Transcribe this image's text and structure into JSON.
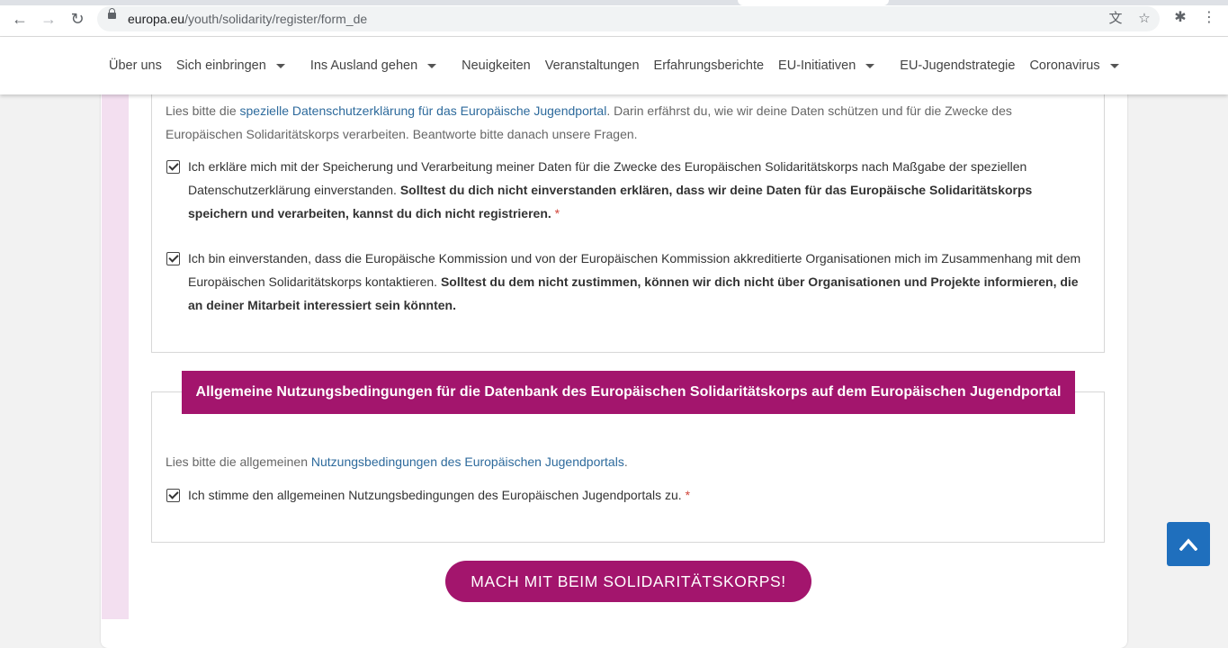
{
  "browser": {
    "url_domain": "europa.eu",
    "url_path": "/youth/solidarity/register/form_de",
    "back_icon": "←",
    "forward_icon": "→",
    "reload_icon": "↻",
    "translate_icon": "文",
    "star_icon": "☆",
    "extensions_icon": "✱",
    "menu_icon": "⋮"
  },
  "nav": {
    "items": [
      {
        "label": "Über uns",
        "dropdown": false
      },
      {
        "label": "Sich einbringen",
        "dropdown": true
      },
      {
        "label": "Ins Ausland gehen",
        "dropdown": true
      },
      {
        "label": "Neuigkeiten",
        "dropdown": false
      },
      {
        "label": "Veranstaltungen",
        "dropdown": false
      },
      {
        "label": "Erfahrungsberichte",
        "dropdown": false
      },
      {
        "label": "EU-Initiativen",
        "dropdown": true
      },
      {
        "label": "EU-Jugendstrategie",
        "dropdown": false
      },
      {
        "label": "Coronavirus",
        "dropdown": true
      }
    ]
  },
  "privacy": {
    "intro_prefix": "Lies bitte die ",
    "intro_link": "spezielle Datenschutzerklärung für das Europäische Jugendportal",
    "intro_suffix": ". Darin erfährst du, wie wir deine Daten schützen und für die Zwecke des Europäischen Solidaritätskorps verarbeiten. Beantworte bitte danach unsere Fragen.",
    "consent1_text": "Ich erkläre mich mit der Speicherung und Verarbeitung meiner Daten für die Zwecke des Europäischen Solidaritätskorps nach Maßgabe der speziellen Datenschutzerklärung einverstanden. ",
    "consent1_bold": "Solltest du dich nicht einverstanden erklären, dass wir deine Daten für das Europäische Solidaritätskorps speichern und verarbeiten, kannst du dich nicht registrieren.",
    "consent1_required": "*",
    "consent1_checked": true,
    "consent2_text": "Ich bin einverstanden, dass die Europäische Kommission und von der Europäischen Kommission akkreditierte Organisationen mich im Zusammenhang mit dem Europäischen Solidaritätskorps kontaktieren. ",
    "consent2_bold": "Solltest du dem nicht zustimmen, können wir dich nicht über Organisationen und Projekte informieren, die an deiner Mitarbeit interessiert sein könnten.",
    "consent2_checked": true
  },
  "terms": {
    "heading": "Allgemeine Nutzungsbedingungen für die Datenbank des Europäischen Solidaritätskorps auf dem Europäischen Jugendportal",
    "intro_prefix": "Lies bitte die allgemeinen ",
    "intro_link": "Nutzungsbedingungen des Europäischen Jugendportals",
    "intro_suffix": ".",
    "accept_text": "Ich stimme den allgemeinen Nutzungsbedingungen des Europäischen Jugendportals zu.",
    "accept_required": "*",
    "accept_checked": true
  },
  "submit_label": "MACH MIT BEIM SOLIDARITÄTSKORPS!",
  "colors": {
    "brand": "#a3156d",
    "link": "#2d6a9c",
    "scroll_top_button": "#1f6fbd",
    "accent_bar": "#f3dff0"
  }
}
